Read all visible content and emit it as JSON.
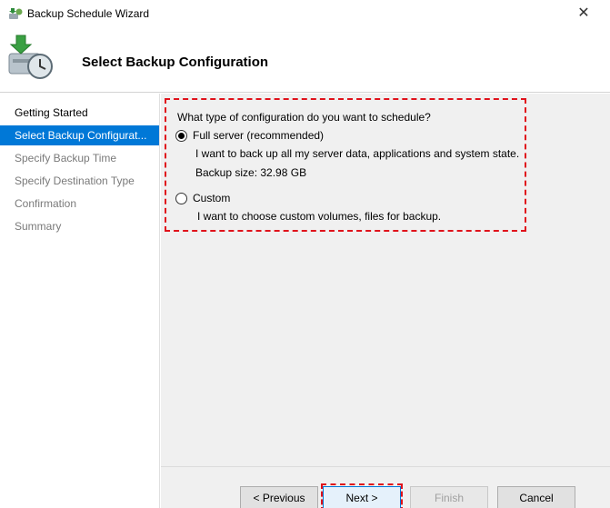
{
  "window": {
    "title": "Backup Schedule Wizard",
    "close_glyph": "✕"
  },
  "header": {
    "page_title": "Select Backup Configuration"
  },
  "sidebar": {
    "items": [
      {
        "label": "Getting Started",
        "state": "done"
      },
      {
        "label": "Select Backup Configurat...",
        "state": "active"
      },
      {
        "label": "Specify Backup Time",
        "state": "pending"
      },
      {
        "label": "Specify Destination Type",
        "state": "pending"
      },
      {
        "label": "Confirmation",
        "state": "pending"
      },
      {
        "label": "Summary",
        "state": "pending"
      }
    ]
  },
  "main": {
    "question": "What type of configuration do you want to schedule?",
    "options": [
      {
        "label": "Full server (recommended)",
        "checked": true,
        "description": "I want to back up all my server data, applications and system state.",
        "detail": "Backup size: 32.98 GB"
      },
      {
        "label": "Custom",
        "checked": false,
        "description": "I want to choose custom volumes, files for backup."
      }
    ]
  },
  "footer": {
    "previous_label": "< Previous",
    "next_label": "Next >",
    "finish_label": "Finish",
    "cancel_label": "Cancel"
  },
  "colors": {
    "accent": "#0078d7",
    "highlight": "#e0121b"
  }
}
